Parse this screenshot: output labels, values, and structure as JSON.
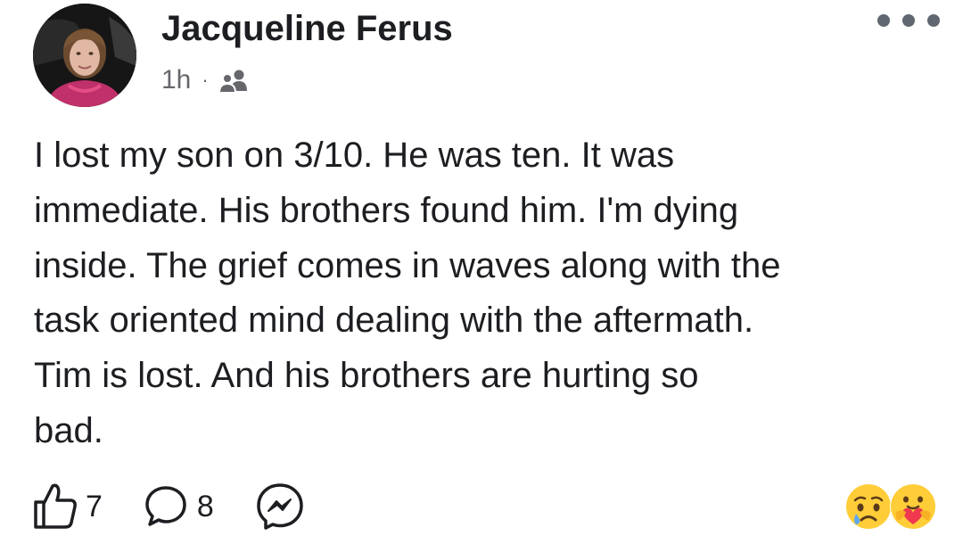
{
  "post": {
    "author": "Jacqueline Ferus",
    "timestamp": "1h",
    "separator": "·",
    "audience_icon": "friends-icon",
    "text": "I lost my son on 3/10. He was ten. It was\nimmediate. His brothers found him. I'm dying\ninside. The grief comes in waves along with the\ntask oriented mind dealing with the aftermath.\nTim is lost. And his brothers are hurting so\nbad."
  },
  "actions": {
    "like_count": "7",
    "comment_count": "8",
    "like_icon": "thumbs-up-icon",
    "comment_icon": "comment-bubble-icon",
    "messenger_icon": "messenger-icon"
  },
  "reactions": {
    "icons": [
      "sad-reaction-icon",
      "care-reaction-icon"
    ]
  },
  "colors": {
    "text": "#1c1e21",
    "secondary_text": "#65676b",
    "reaction_yellow": "#ffcd38"
  }
}
